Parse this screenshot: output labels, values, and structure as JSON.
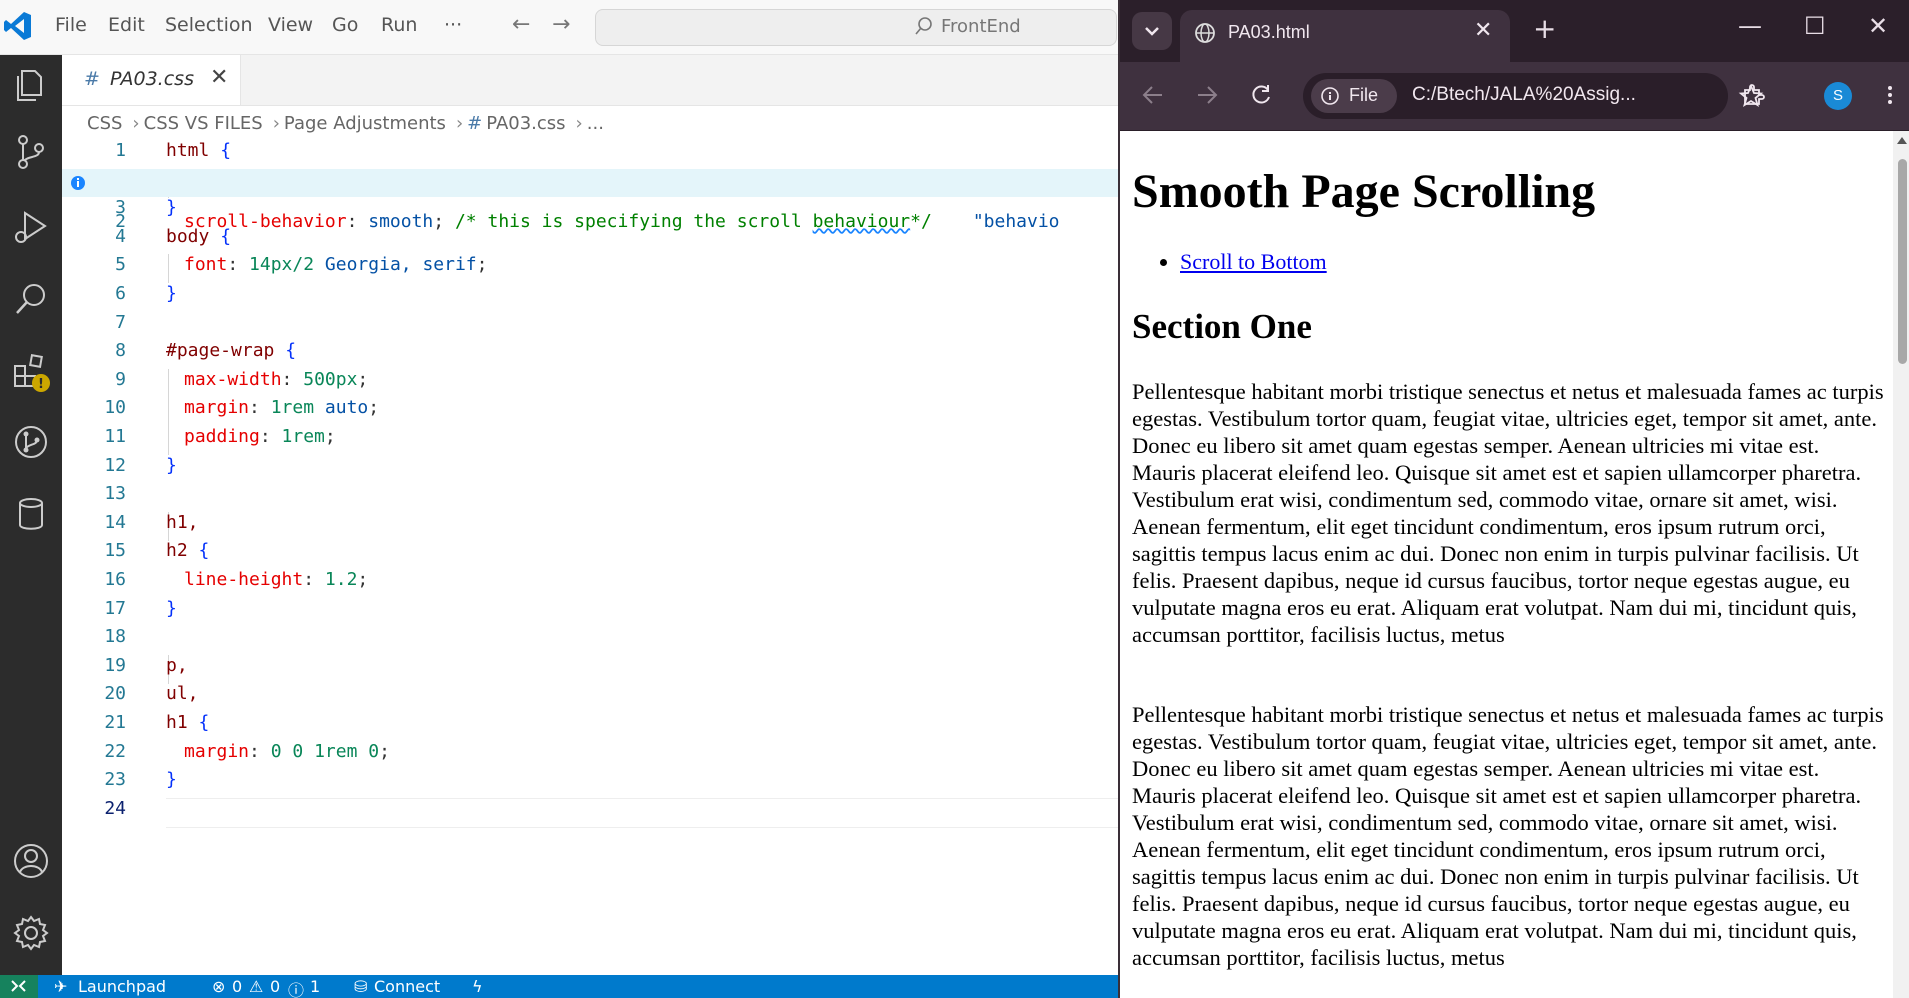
{
  "vscode": {
    "menu": [
      "File",
      "Edit",
      "Selection",
      "View",
      "Go",
      "Run",
      "···"
    ],
    "search_text": "FrontEnd",
    "tab": {
      "hash": "#",
      "label": "PA03.css",
      "close": "✕"
    },
    "breadcrumb": [
      "CSS",
      "CSS VS FILES",
      "Page Adjustments",
      "PA03.css",
      "..."
    ],
    "code_lines": [
      "1",
      "2",
      "3",
      "4",
      "5",
      "6",
      "7",
      "8",
      "9",
      "10",
      "11",
      "12",
      "13",
      "14",
      "15",
      "16",
      "17",
      "18",
      "19",
      "20",
      "21",
      "22",
      "23",
      "24"
    ],
    "code": {
      "l1_sel": "html",
      "l2_prop": "scroll-behavior",
      "l2_val": "smooth",
      "l2_comment_a": "/* this is specifying the scroll ",
      "l2_comment_b": "behaviour",
      "l2_comment_c": "*/",
      "l2_hint": "\"behavio",
      "l4_sel": "body",
      "l5_prop": "font",
      "l5_num": "14px/2",
      "l5_val": "Georgia, serif",
      "l8_sel": "#page-wrap",
      "l9_prop": "max-width",
      "l9_num": "500px",
      "l10_prop": "margin",
      "l10_num": "1rem",
      "l10_val": "auto",
      "l11_prop": "padding",
      "l11_num": "1rem",
      "l14_sel": "h1,",
      "l15_sel": "h2",
      "l16_prop": "line-height",
      "l16_num": "1.2",
      "l19_sel": "p,",
      "l20_sel": "ul,",
      "l21_sel": "h1",
      "l22_prop": "margin",
      "l22_num": "0 0 1rem 0"
    },
    "status": {
      "launchpad": "Launchpad",
      "errors": "0",
      "warnings": "0",
      "infos": "1",
      "connect": "Connect"
    }
  },
  "browser": {
    "tab_title": "PA03.html",
    "chip_label": "File",
    "url": "C:/Btech/JALA%20Assig...",
    "profile_initial": "S",
    "page": {
      "h1": "Smooth Page Scrolling",
      "link": "Scroll to Bottom",
      "h2": "Section One",
      "para1": "Pellentesque habitant morbi tristique senectus et netus et malesuada fames ac turpis egestas. Vestibulum tortor quam, feugiat vitae, ultricies eget, tempor sit amet, ante. Donec eu libero sit amet quam egestas semper. Aenean ultricies mi vitae est. Mauris placerat eleifend leo. Quisque sit amet est et sapien ullamcorper pharetra. Vestibulum erat wisi, condimentum sed, commodo vitae, ornare sit amet, wisi. Aenean fermentum, elit eget tincidunt condimentum, eros ipsum rutrum orci, sagittis tempus lacus enim ac dui. Donec non enim in turpis pulvinar facilisis. Ut felis. Praesent dapibus, neque id cursus faucibus, tortor neque egestas augue, eu vulputate magna eros eu erat. Aliquam erat volutpat. Nam dui mi, tincidunt quis, accumsan porttitor, facilisis luctus, metus",
      "para2": "Pellentesque habitant morbi tristique senectus et netus et malesuada fames ac turpis egestas. Vestibulum tortor quam, feugiat vitae, ultricies eget, tempor sit amet, ante. Donec eu libero sit amet quam egestas semper. Aenean ultricies mi vitae est. Mauris placerat eleifend leo. Quisque sit amet est et sapien ullamcorper pharetra. Vestibulum erat wisi, condimentum sed, commodo vitae, ornare sit amet, wisi. Aenean fermentum, elit eget tincidunt condimentum, eros ipsum rutrum orci, sagittis tempus lacus enim ac dui. Donec non enim in turpis pulvinar facilisis. Ut felis. Praesent dapibus, neque id cursus faucibus, tortor neque egestas augue, eu vulputate magna eros eu erat. Aliquam erat volutpat. Nam dui mi, tincidunt quis, accumsan porttitor, facilisis luctus, metus"
    }
  },
  "colors": {
    "vscode_accent": "#007acc",
    "activity_bar": "#2c2c2c",
    "browser_frame": "#3f313f",
    "link": "#0000ee"
  }
}
